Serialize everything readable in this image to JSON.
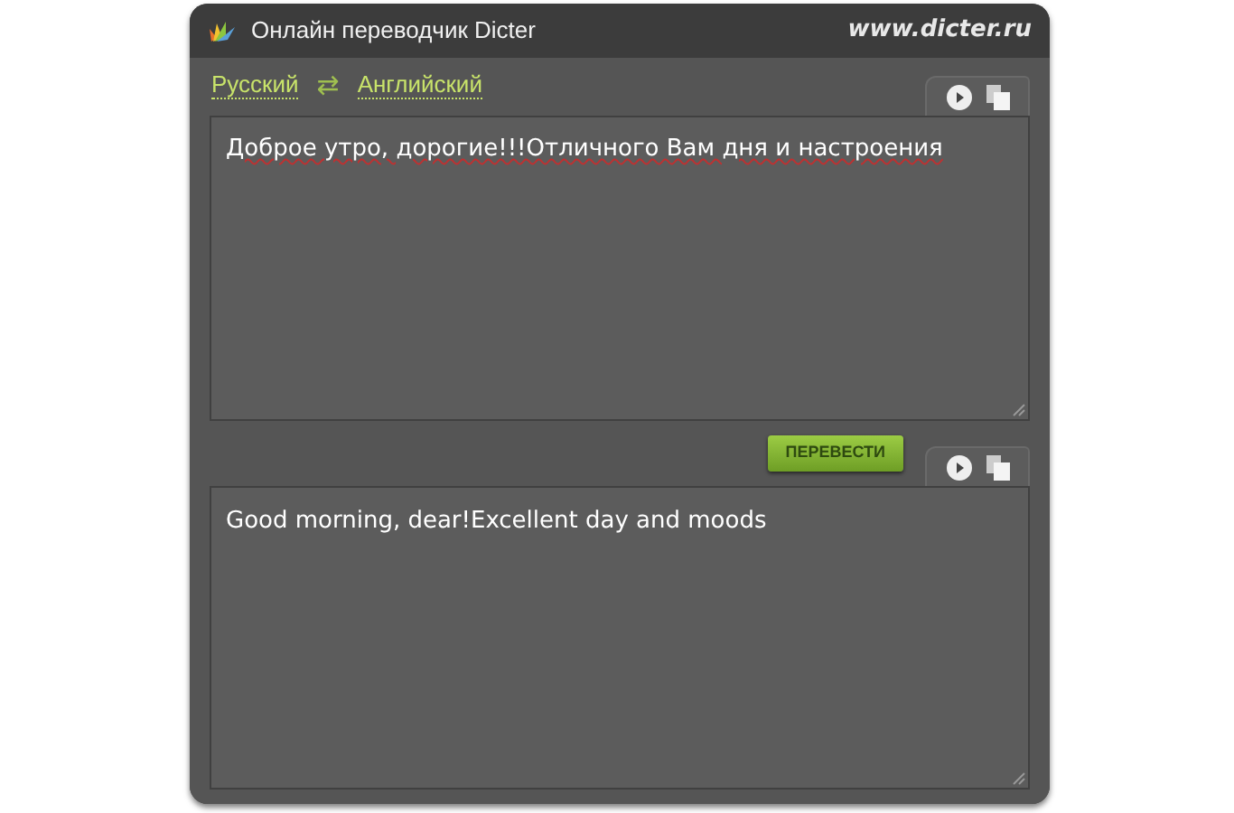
{
  "window": {
    "title": "Онлайн переводчик Dicter",
    "site": "www.dicter.ru"
  },
  "languages": {
    "source": "Русский",
    "swap": "⇄",
    "target": "Английский"
  },
  "source": {
    "text": "Доброе утро, дорогие!!!Отличного Вам дня и настроения"
  },
  "translate_button": "ПЕРЕВЕСТИ",
  "result": {
    "text": "Good morning, dear!Excellent day and moods"
  }
}
